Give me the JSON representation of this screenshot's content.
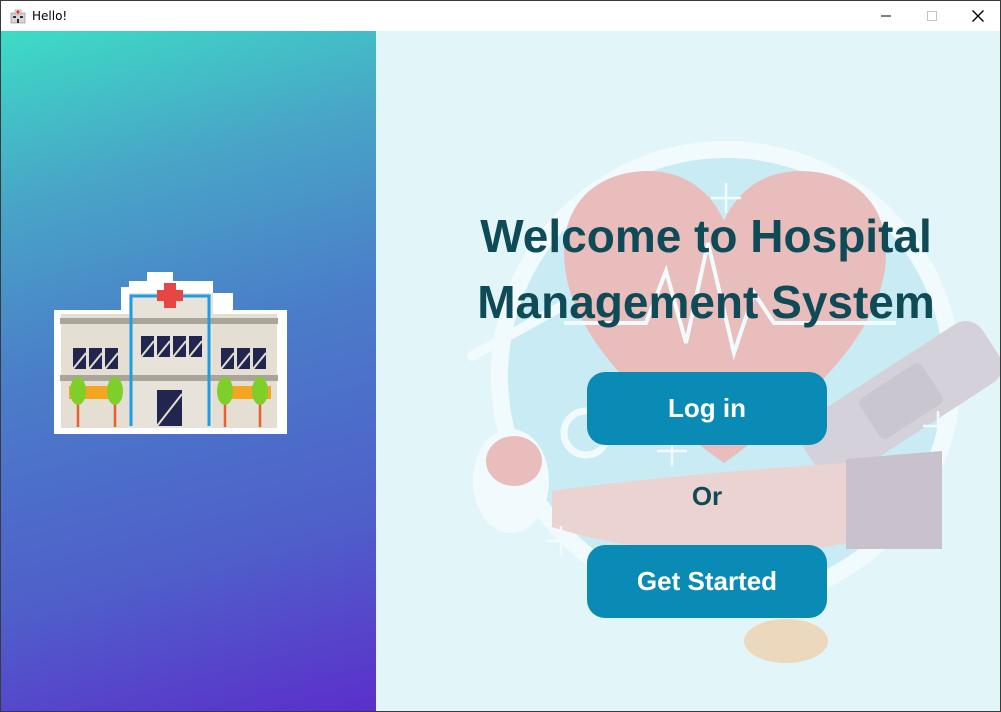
{
  "window": {
    "title": "Hello!"
  },
  "icons": {
    "app": "hospital-icon",
    "minimize": "minimize-icon",
    "maximize": "maximize-icon",
    "close": "close-icon",
    "illustration": "hospital-building-icon",
    "background": "heart-medical-illustration"
  },
  "main": {
    "heading_line1": "Welcome to Hospital",
    "heading_line2": "Management System",
    "login_label": "Log in",
    "or_label": "Or",
    "get_started_label": "Get Started"
  },
  "colors": {
    "button": "#0a8bb6",
    "heading": "#0f4a57",
    "panel_bg": "#e2f6fa",
    "gradient_top": "#3ddcc6",
    "gradient_bottom": "#5b2fcb"
  }
}
